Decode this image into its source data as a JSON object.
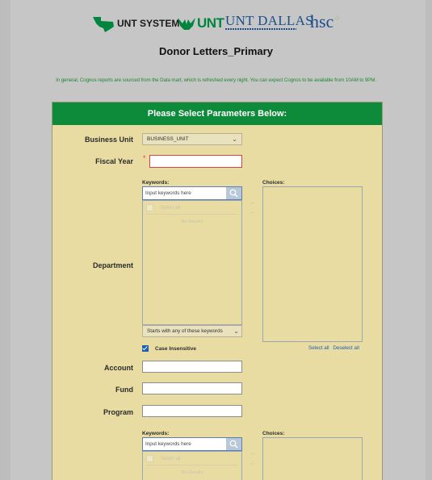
{
  "logos": {
    "unt_system": "UNT SYSTEM",
    "unt": "UNT",
    "unt_dallas": "UNT DALLAS",
    "hsc": "hsc"
  },
  "page": {
    "title": "Donor Letters_Primary",
    "notice": "In general, Cognos reports are sourced from the Data mart, which is refreshed every night. You can expect Cognos to be available from 10AM to 9PM."
  },
  "panel": {
    "header": "Please Select Parameters Below:",
    "business_unit": {
      "label": "Business Unit",
      "value": "BUSINESS_UNIT"
    },
    "fiscal_year": {
      "label": "Fiscal Year",
      "required_mark": "*"
    },
    "department": {
      "label": "Department",
      "keywords_label": "Keywords:",
      "search_placeholder": "Input keywords here",
      "select_all": "Select all",
      "no_results": "No Results",
      "choices_label": "Choices:",
      "match_mode": "Starts with any of these keywords",
      "case_insensitive": "Case Insensitive",
      "choices_select_all": "Select all",
      "choices_deselect_all": "Deselect all"
    },
    "account": {
      "label": "Account"
    },
    "fund": {
      "label": "Fund"
    },
    "program": {
      "label": "Program",
      "keywords_label": "Keywords:",
      "search_placeholder": "Input keywords here",
      "select_all": "Select all",
      "no_results": "No Results",
      "choices_label": "Choices:"
    }
  },
  "colors": {
    "header_green": "#0d8a3a",
    "panel_bg": "#e8dca3",
    "notice_green": "#1f8a2c",
    "link_blue": "#1f5fb0"
  }
}
